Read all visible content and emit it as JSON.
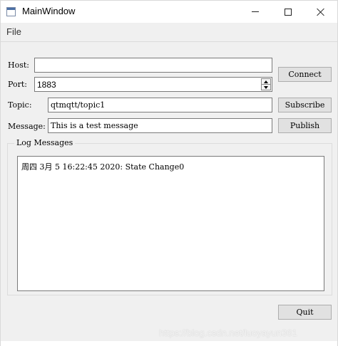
{
  "window": {
    "title": "MainWindow",
    "controls": {
      "minimize_icon": "minimize-icon",
      "maximize_icon": "maximize-icon",
      "close_icon": "close-icon"
    }
  },
  "menu": {
    "file_label": "File"
  },
  "form": {
    "host_label": "Host:",
    "host_value": "",
    "port_label": "Port:",
    "port_value": "1883",
    "topic_label": "Topic:",
    "topic_value": "qtmqtt/topic1",
    "message_label": "Message:",
    "message_value": "This is a test message"
  },
  "buttons": {
    "connect": "Connect",
    "subscribe": "Subscribe",
    "publish": "Publish",
    "quit": "Quit"
  },
  "log": {
    "group_title": "Log Messages",
    "lines": [
      "周四 3月 5 16:22:45 2020: State Change0"
    ]
  },
  "watermark": "https://blog.csdn.net/luoyayun361"
}
